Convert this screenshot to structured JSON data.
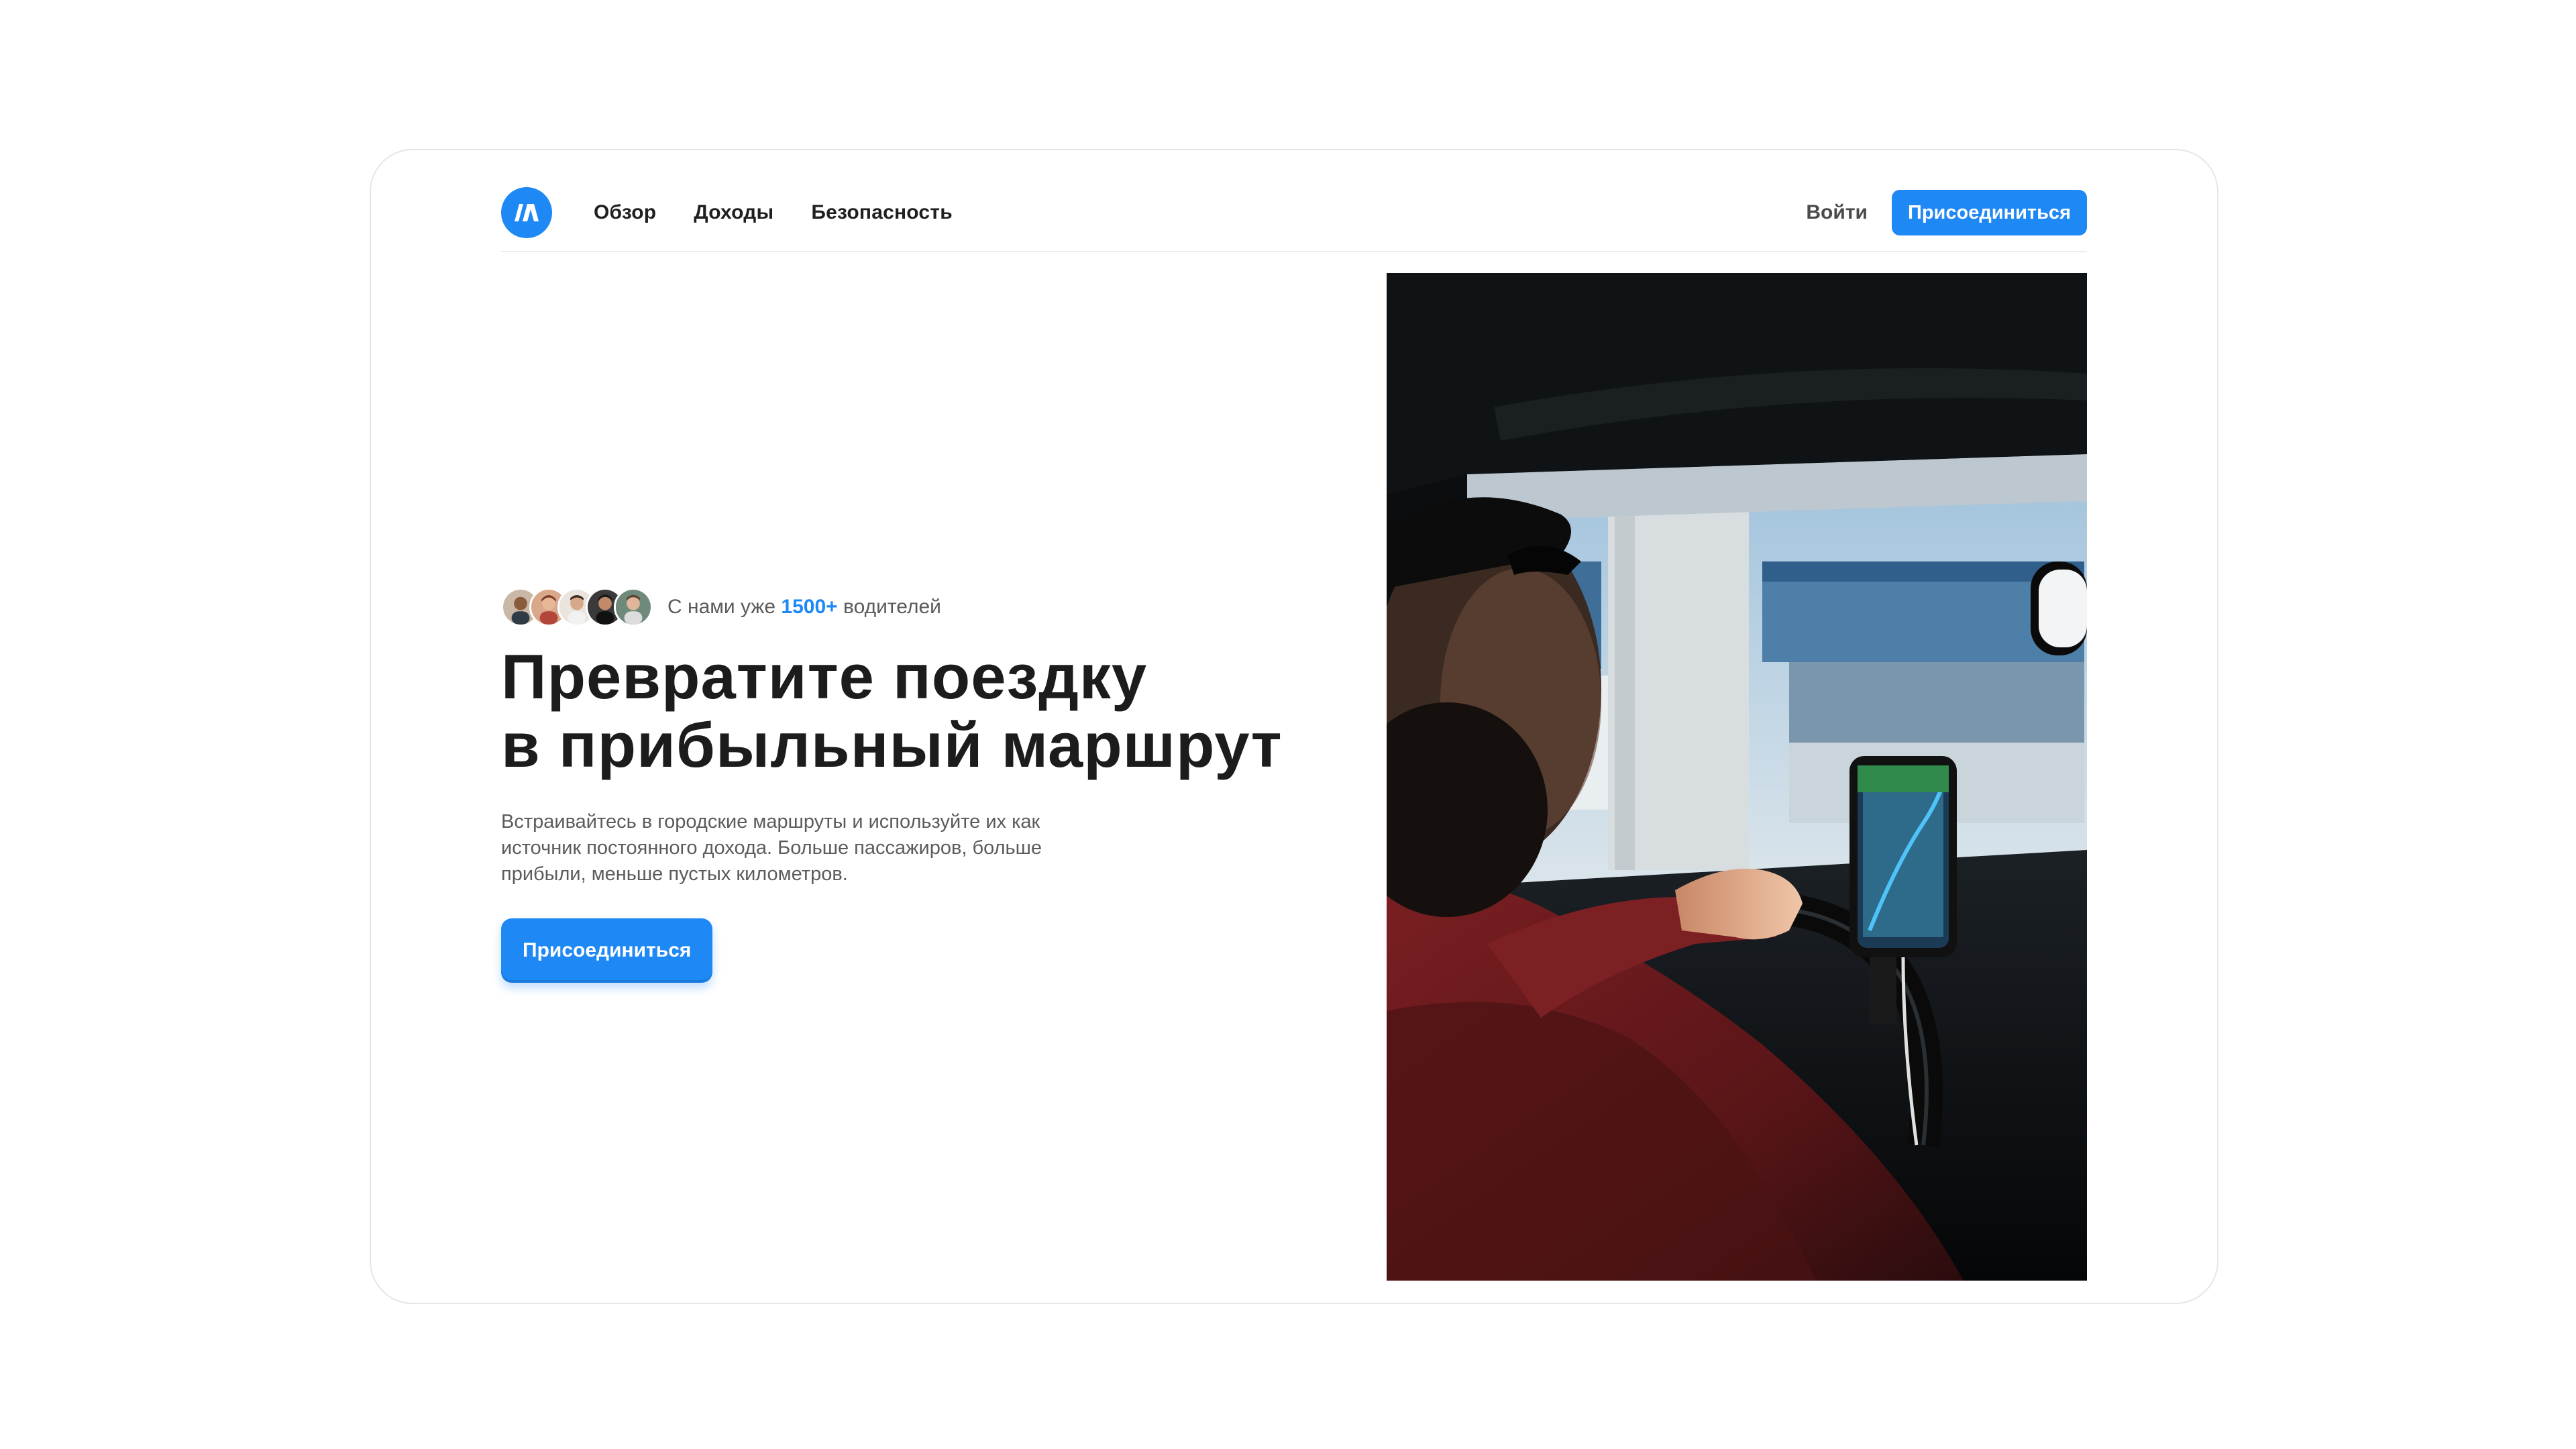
{
  "brand": {
    "name": "logo",
    "color": "#1e88f5"
  },
  "nav": {
    "links": [
      {
        "label": "Обзор"
      },
      {
        "label": "Доходы"
      },
      {
        "label": "Безопасность"
      }
    ],
    "login_label": "Войти",
    "join_label": "Присоединиться"
  },
  "hero": {
    "social": {
      "prefix": "С нами уже",
      "count": "1500+",
      "suffix": "водителей",
      "avatars": [
        "avatar-1",
        "avatar-2",
        "avatar-3",
        "avatar-4",
        "avatar-5"
      ]
    },
    "headline_line1": "Превратите поездку",
    "headline_line2": "в прибыльный маршрут",
    "subtitle": "Встраивайтесь в городские маршруты и используйте их как источник постоянного дохода. Больше пассажиров, больше прибыли, меньше пустых километров.",
    "join_label": "Присоединиться",
    "image_subject": "driver-with-phone-navigation-photo"
  },
  "colors": {
    "accent": "#1e88f5",
    "text_primary": "#1c1c1c",
    "text_secondary": "#5b5b5b"
  }
}
